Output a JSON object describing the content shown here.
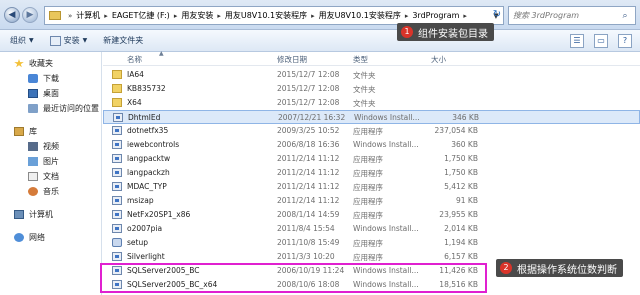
{
  "address": {
    "crumbs": [
      "计算机",
      "EAGET亿捷 (F:)",
      "用友安装",
      "用友U8V10.1安装程序",
      "用友U8V10.1安装程序",
      "3rdProgram"
    ],
    "search_placeholder": "搜索 3rdProgram"
  },
  "toolbar": {
    "organize": "组织",
    "install": "安装",
    "new_folder": "新建文件夹"
  },
  "sidebar": {
    "favorites": "收藏夹",
    "downloads": "下载",
    "desktop": "桌面",
    "recent": "最近访问的位置",
    "libraries": "库",
    "videos": "视频",
    "pictures": "图片",
    "documents": "文档",
    "music": "音乐",
    "computer": "计算机",
    "network": "网络"
  },
  "columns": {
    "name": "名称",
    "date": "修改日期",
    "type": "类型",
    "size": "大小"
  },
  "files": [
    {
      "name": "IA64",
      "date": "2015/12/7 12:08",
      "type": "文件夹",
      "size": "",
      "icon": "folder"
    },
    {
      "name": "KB835732",
      "date": "2015/12/7 12:08",
      "type": "文件夹",
      "size": "",
      "icon": "folder"
    },
    {
      "name": "X64",
      "date": "2015/12/7 12:08",
      "type": "文件夹",
      "size": "",
      "icon": "folder"
    },
    {
      "name": "DhtmlEd",
      "date": "2007/12/21 16:32",
      "type": "Windows Install...",
      "size": "346 KB",
      "icon": "exe"
    },
    {
      "name": "dotnetfx35",
      "date": "2009/3/25 10:52",
      "type": "应用程序",
      "size": "237,054 KB",
      "icon": "exe"
    },
    {
      "name": "iewebcontrols",
      "date": "2006/8/18 16:36",
      "type": "Windows Install...",
      "size": "360 KB",
      "icon": "exe"
    },
    {
      "name": "langpacktw",
      "date": "2011/2/14 11:12",
      "type": "应用程序",
      "size": "1,750 KB",
      "icon": "exe"
    },
    {
      "name": "langpackzh",
      "date": "2011/2/14 11:12",
      "type": "应用程序",
      "size": "1,750 KB",
      "icon": "exe"
    },
    {
      "name": "MDAC_TYP",
      "date": "2011/2/14 11:12",
      "type": "应用程序",
      "size": "5,412 KB",
      "icon": "exe"
    },
    {
      "name": "msizap",
      "date": "2011/2/14 11:12",
      "type": "应用程序",
      "size": "91 KB",
      "icon": "exe"
    },
    {
      "name": "NetFx20SP1_x86",
      "date": "2008/1/14 14:59",
      "type": "应用程序",
      "size": "23,955 KB",
      "icon": "exe"
    },
    {
      "name": "o2007pia",
      "date": "2011/8/4 15:54",
      "type": "Windows Install...",
      "size": "2,014 KB",
      "icon": "exe"
    },
    {
      "name": "setup",
      "date": "2011/10/8 15:49",
      "type": "应用程序",
      "size": "1,194 KB",
      "icon": "cd"
    },
    {
      "name": "Silverlight",
      "date": "2011/3/3 10:20",
      "type": "应用程序",
      "size": "6,157 KB",
      "icon": "exe"
    },
    {
      "name": "SQLServer2005_BC",
      "date": "2006/10/19 11:24",
      "type": "Windows Install...",
      "size": "11,426 KB",
      "icon": "exe"
    },
    {
      "name": "SQLServer2005_BC_x64",
      "date": "2008/10/6 18:08",
      "type": "Windows Install...",
      "size": "18,516 KB",
      "icon": "exe"
    }
  ],
  "annotations": {
    "a1_num": "1",
    "a1_text": "组件安装包目录",
    "a2_num": "2",
    "a2_text": "根据操作系统位数判断"
  }
}
